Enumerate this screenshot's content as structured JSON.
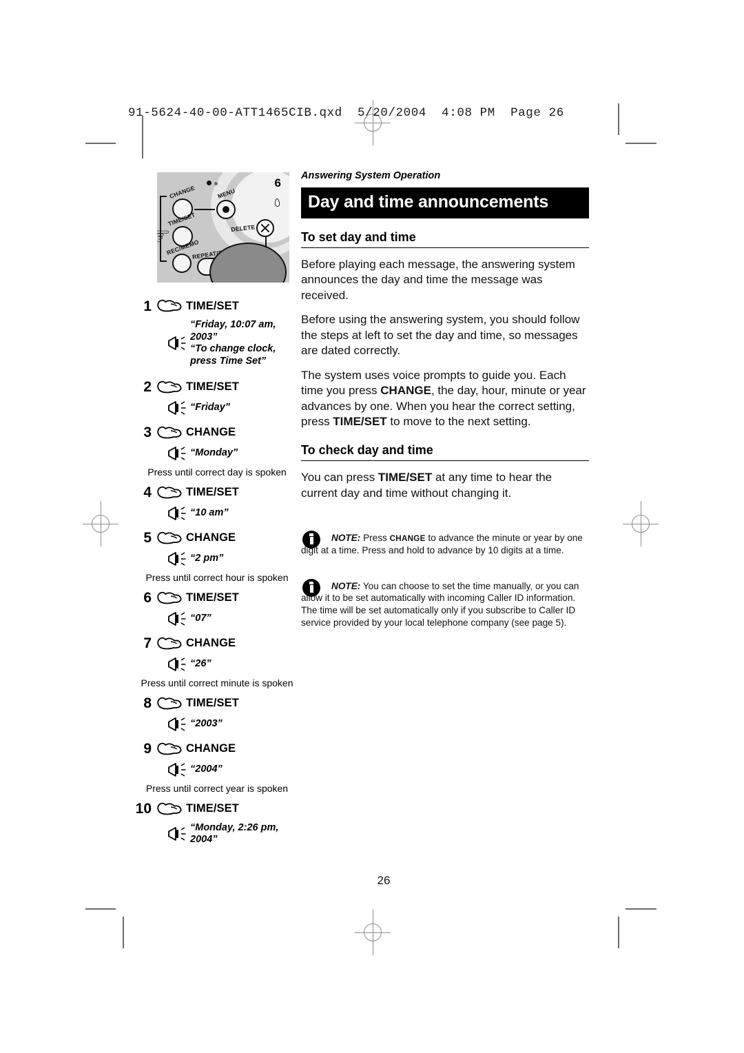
{
  "prepress": {
    "header_line": "91-5624-40-00-ATT1465CIB.qxd  5/20/2004  4:08 PM  Page 26"
  },
  "page": {
    "folio": "26",
    "kicker": "Answering System Operation",
    "title": "Day and time announcements"
  },
  "device": {
    "callout_number": "6",
    "buttons": [
      {
        "label": "CHANGE"
      },
      {
        "label": "MENU"
      },
      {
        "label": "TIME/SET"
      },
      {
        "label": "REC/MEMO"
      },
      {
        "label": "REPEAT/SLOW"
      },
      {
        "label": "DELETE"
      }
    ]
  },
  "steps": [
    {
      "num": "1",
      "key": "TIME/SET",
      "spoken": "“Friday, 10:07 am, 2003”",
      "spoken2": "“To change clock,",
      "spoken3": "press Time Set”",
      "hint": ""
    },
    {
      "num": "2",
      "key": "TIME/SET",
      "spoken": "“Friday”",
      "hint": ""
    },
    {
      "num": "3",
      "key": "CHANGE",
      "spoken": "“Monday”",
      "hint": "Press until correct day is spoken"
    },
    {
      "num": "4",
      "key": "TIME/SET",
      "spoken": "“10 am”",
      "hint": ""
    },
    {
      "num": "5",
      "key": "CHANGE",
      "spoken": "“2 pm”",
      "hint": "Press until correct hour is spoken"
    },
    {
      "num": "6",
      "key": "TIME/SET",
      "spoken": "“07”",
      "hint": ""
    },
    {
      "num": "7",
      "key": "CHANGE",
      "spoken": "“26”",
      "hint": "Press until correct minute is spoken"
    },
    {
      "num": "8",
      "key": "TIME/SET",
      "spoken": "“2003”",
      "hint": ""
    },
    {
      "num": "9",
      "key": "CHANGE",
      "spoken": "“2004”",
      "hint": "Press until correct year is spoken"
    },
    {
      "num": "10",
      "key": "TIME/SET",
      "spoken": "“Monday, 2:26 pm, 2004”",
      "hint": ""
    }
  ],
  "sections": {
    "set": {
      "heading": "To set day and time",
      "p1": "Before playing each message, the answering system announces the day and time the message was received.",
      "p2": "Before using the answering system, you should follow the steps at left to set the day and time, so messages are dated correctly.",
      "p3a": "The system uses voice prompts to guide you. Each time you press ",
      "p3_key1": "CHANGE",
      "p3b": ", the day, hour, minute or year advances by one. When you hear the correct setting, press ",
      "p3_key2": "TIME/SET",
      "p3c": " to move to the next setting."
    },
    "check": {
      "heading": "To check day and time",
      "p1a": "You can press ",
      "p1_key": "TIME/SET",
      "p1b": " at any time to hear the current day and time without changing it."
    }
  },
  "notes": [
    {
      "label": "NOTE:",
      "text_a": " Press ",
      "key": "CHANGE",
      "text_b": " to advance the minute or year by one digit at a time. Press and hold to advance by 10 digits at a time."
    },
    {
      "label": "NOTE:",
      "text_a": " You can choose to set the time manually, or you can allow it to be set automatically with incoming Caller ID information. The time will be set automatically only if you subscribe to Caller ID service provided by your local telephone company (see page 5).",
      "key": "",
      "text_b": ""
    }
  ],
  "colors": {
    "title_bar_bg": "#000000",
    "title_bar_text": "#ffffff",
    "page_bg": "#ffffff",
    "crop_mark": "#6b6b6b",
    "device_body": "#c9c9c9"
  }
}
